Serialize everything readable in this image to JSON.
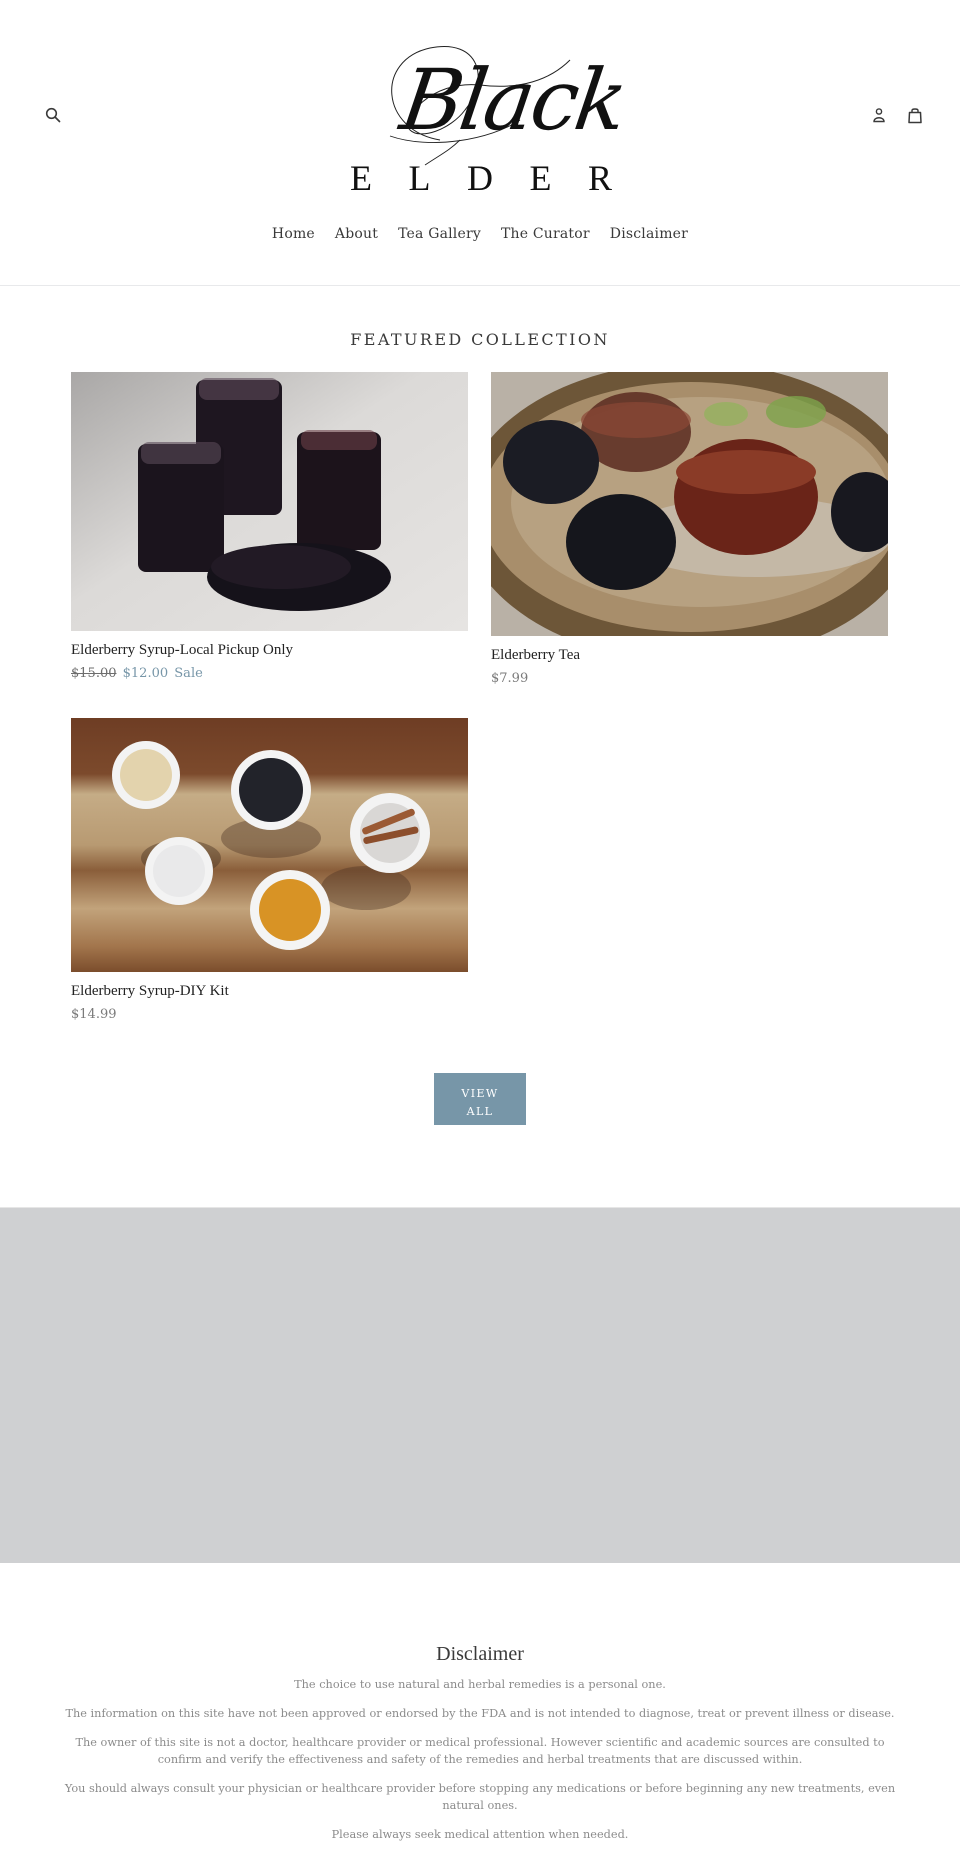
{
  "header": {
    "logo": {
      "script": "Black",
      "wordmark": [
        "E",
        "L",
        "D",
        "E",
        "R"
      ]
    },
    "icons": {
      "search": "search-icon",
      "account": "account-icon",
      "cart": "cart-icon"
    },
    "nav": [
      {
        "label": "Home"
      },
      {
        "label": "About"
      },
      {
        "label": "Tea Gallery"
      },
      {
        "label": "The Curator"
      },
      {
        "label": "Disclaimer"
      }
    ]
  },
  "featured": {
    "title": "FEATURED COLLECTION",
    "products": [
      {
        "title": "Elderberry Syrup-Local Pickup Only",
        "price_original": "$15.00",
        "price_sale": "$12.00",
        "sale_label": "Sale",
        "image": "elderberry-syrup-jars"
      },
      {
        "title": "Elderberry Tea",
        "price": "$7.99",
        "image": "elderberry-tea-cups"
      },
      {
        "title": "Elderberry Syrup-DIY Kit",
        "price": "$14.99",
        "image": "spice-bowls-kit"
      }
    ],
    "view_all": {
      "line1": "VIEW",
      "line2": "ALL"
    }
  },
  "colors": {
    "accent": "#7796a8",
    "placeholder": "#cfd0d2",
    "text": "#3a3a3a",
    "muted": "#8b8b8b"
  },
  "disclaimer": {
    "title": "Disclaimer",
    "paragraphs": [
      "The choice to use natural and herbal remedies is a personal one.",
      "The information on this site have not been approved or endorsed by the FDA and is not intended to diagnose, treat or prevent illness or disease.",
      "The owner of this site is not a doctor, healthcare provider or medical professional. However scientific and academic sources are consulted to confirm and verify the effectiveness and safety of the remedies and herbal treatments that are discussed within.",
      "You should always consult your physician or healthcare provider before stopping any medications or before beginning any new treatments, even natural ones.",
      "Please always seek medical attention when needed."
    ]
  }
}
